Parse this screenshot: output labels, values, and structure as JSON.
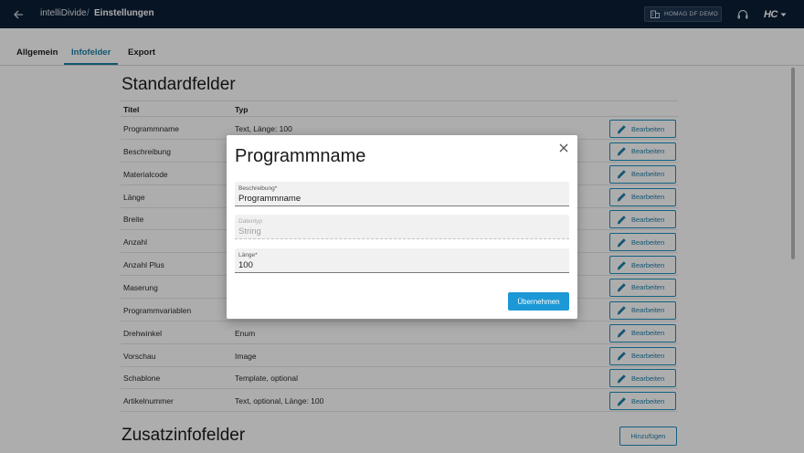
{
  "header": {
    "app_name": "intelliDivide",
    "separator": "/",
    "page_name": "Einstellungen",
    "tenant": "HOMAG DF DEMO",
    "brand": "HC"
  },
  "tabs": [
    {
      "label": "Allgemein",
      "active": false
    },
    {
      "label": "Infofelder",
      "active": true
    },
    {
      "label": "Export",
      "active": false
    }
  ],
  "standard": {
    "title": "Standardfelder",
    "columns": [
      "Titel",
      "Typ"
    ],
    "edit_label": "Bearbeiten",
    "rows": [
      {
        "title": "Programmname",
        "type": "Text, Länge: 100"
      },
      {
        "title": "Beschreibung",
        "type": ""
      },
      {
        "title": "Materialcode",
        "type": ""
      },
      {
        "title": "Länge",
        "type": ""
      },
      {
        "title": "Breite",
        "type": ""
      },
      {
        "title": "Anzahl",
        "type": ""
      },
      {
        "title": "Anzahl Plus",
        "type": ""
      },
      {
        "title": "Maserung",
        "type": ""
      },
      {
        "title": "Programmvariablen",
        "type": ""
      },
      {
        "title": "Drehwinkel",
        "type": "Enum"
      },
      {
        "title": "Vorschau",
        "type": "Image"
      },
      {
        "title": "Schablone",
        "type": "Template, optional"
      },
      {
        "title": "Artikelnummer",
        "type": "Text, optional, Länge: 100"
      }
    ]
  },
  "additional": {
    "title": "Zusatzinfofelder",
    "add_label": "Hinzufügen"
  },
  "modal": {
    "title": "Programmname",
    "fields": [
      {
        "label": "Beschreibung*",
        "value": "Programmname",
        "disabled": false
      },
      {
        "label": "Datentyp",
        "value": "String",
        "disabled": true
      },
      {
        "label": "Länge*",
        "value": "100",
        "disabled": false
      }
    ],
    "apply_label": "Übernehmen"
  },
  "colors": {
    "topbar": "#0b1e34",
    "accent": "#1d7fa8",
    "primary_button": "#1d98d6"
  }
}
